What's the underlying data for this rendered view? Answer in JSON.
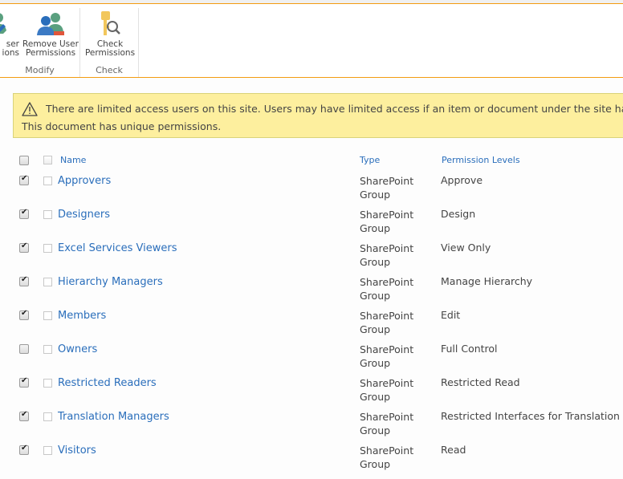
{
  "ribbon": {
    "groups": [
      {
        "label": "Modify",
        "buttons": [
          {
            "label_line1": "ser",
            "label_line2": "ions",
            "icon": "user-permissions-edit-icon"
          },
          {
            "label_line1": "Remove User",
            "label_line2": "Permissions",
            "icon": "remove-user-permissions-icon"
          }
        ]
      },
      {
        "label": "Check",
        "buttons": [
          {
            "label_line1": "Check",
            "label_line2": "Permissions",
            "icon": "check-permissions-icon"
          }
        ]
      }
    ]
  },
  "alert": {
    "icon": "warning-icon",
    "line1": "There are limited access users on this site. Users may have limited access if an item or document under the site has been sh",
    "line2": "This document has unique permissions."
  },
  "table": {
    "headers": {
      "name": "Name",
      "type": "Type",
      "permission_levels": "Permission Levels"
    },
    "select_all_checked": false,
    "rows": [
      {
        "name": "Approvers",
        "type": "SharePoint Group",
        "permission": "Approve",
        "checked": true
      },
      {
        "name": "Designers",
        "type": "SharePoint Group",
        "permission": "Design",
        "checked": true
      },
      {
        "name": "Excel Services Viewers",
        "type": "SharePoint Group",
        "permission": "View Only",
        "checked": true
      },
      {
        "name": "Hierarchy Managers",
        "type": "SharePoint Group",
        "permission": "Manage Hierarchy",
        "checked": true
      },
      {
        "name": "Members",
        "type": "SharePoint Group",
        "permission": "Edit",
        "checked": true
      },
      {
        "name": "Owners",
        "type": "SharePoint Group",
        "permission": "Full Control",
        "checked": false
      },
      {
        "name": "Restricted Readers",
        "type": "SharePoint Group",
        "permission": "Restricted Read",
        "checked": true
      },
      {
        "name": "Translation Managers",
        "type": "SharePoint Group",
        "permission": "Restricted Interfaces for Translation",
        "checked": true
      },
      {
        "name": "Visitors",
        "type": "SharePoint Group",
        "permission": "Read",
        "checked": true
      }
    ]
  },
  "colors": {
    "accent": "#f39c12",
    "link": "#2a6ebb",
    "alert_bg": "#fdef9e"
  }
}
